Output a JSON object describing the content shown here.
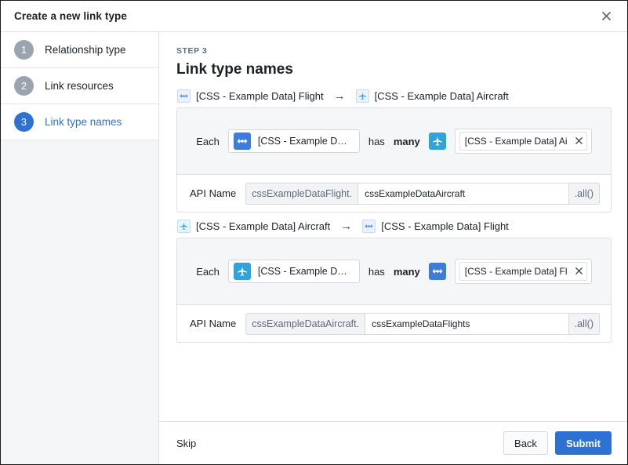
{
  "window": {
    "title": "Create a new link type",
    "close_icon": "close-icon"
  },
  "sidebar": {
    "steps": [
      {
        "number": "1",
        "label": "Relationship type",
        "active": false
      },
      {
        "number": "2",
        "label": "Link resources",
        "active": false
      },
      {
        "number": "3",
        "label": "Link type names",
        "active": true
      }
    ]
  },
  "main": {
    "eyebrow": "STEP 3",
    "title": "Link type names",
    "relations": [
      {
        "head": {
          "source_icon": "link-icon",
          "source_label": "[CSS - Example Data] Flight",
          "arrow": "→",
          "target_icon": "airplane-icon",
          "target_label": "[CSS - Example Data] Aircraft"
        },
        "sentence": {
          "each_label": "Each",
          "subject_icon": "link-icon",
          "subject_text": "[CSS - Example Data] …",
          "has_label": "has",
          "cardinality_label": "many",
          "object_icon": "airplane-icon",
          "object_tag_text": "[CSS - Example Data] Ai",
          "object_tag_remove_icon": "close-icon"
        },
        "api": {
          "label": "API Name",
          "prefix": "cssExampleDataFlight.",
          "value": "cssExampleDataAircraft",
          "suffix": ".all()"
        }
      },
      {
        "head": {
          "source_icon": "airplane-icon",
          "source_label": "[CSS - Example Data] Aircraft",
          "arrow": "→",
          "target_icon": "link-icon",
          "target_label": "[CSS - Example Data] Flight"
        },
        "sentence": {
          "each_label": "Each",
          "subject_icon": "airplane-icon",
          "subject_text": "[CSS - Example Data] …",
          "has_label": "has",
          "cardinality_label": "many",
          "object_icon": "link-icon",
          "object_tag_text": "[CSS - Example Data] Fl",
          "object_tag_remove_icon": "close-icon"
        },
        "api": {
          "label": "API Name",
          "prefix": "cssExampleDataAircraft.",
          "value": "cssExampleDataFlights",
          "suffix": ".all()"
        }
      }
    ]
  },
  "footer": {
    "skip_label": "Skip",
    "back_label": "Back",
    "submit_label": "Submit"
  },
  "colors": {
    "accent": "#2d72d2",
    "link_icon_bg": "#3b7ddd",
    "plane_icon_bg": "#2fa4da",
    "step_inactive_bg": "#9aa4af",
    "panel_bg": "#f5f6f7",
    "sidebar_bg": "#f4f5f7",
    "border": "#dcdfe3"
  }
}
